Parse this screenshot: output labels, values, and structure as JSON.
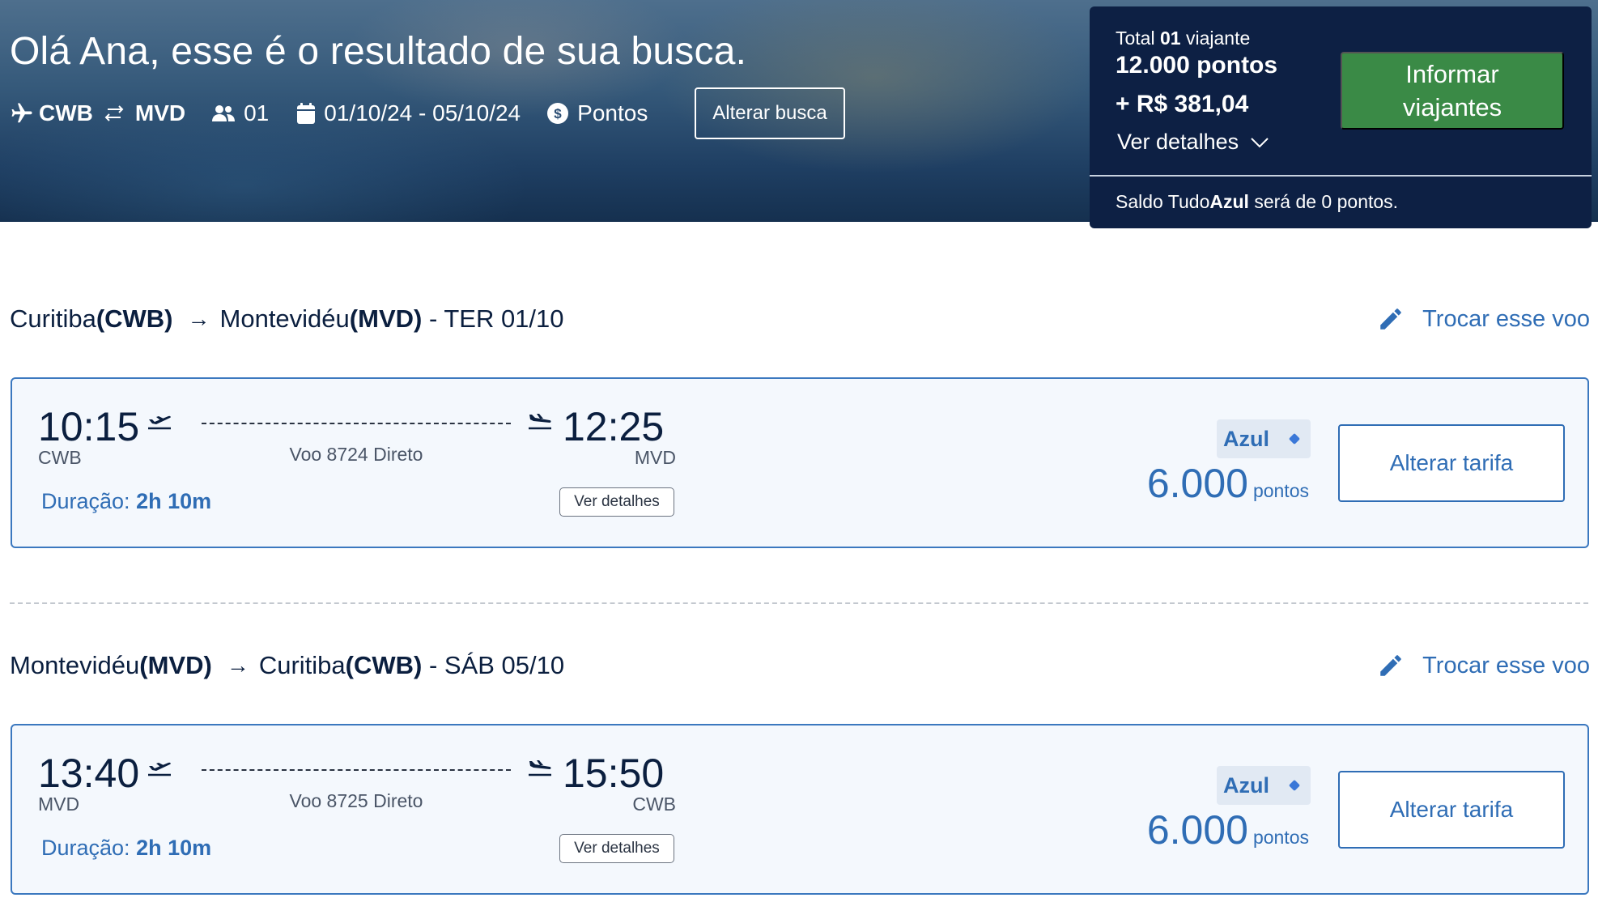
{
  "hero": {
    "greeting": "Olá Ana, esse é o resultado de sua busca.",
    "origin": "CWB",
    "destination": "MVD",
    "passengers": "01",
    "dates": "01/10/24 - 05/10/24",
    "payment": "Pontos",
    "alter_search_label": "Alterar busca"
  },
  "summary": {
    "total_prefix": "Total ",
    "total_count": "01",
    "total_suffix": " viajante",
    "points_total": "12.000 pontos",
    "money_total": "+ R$ 381,04",
    "details_label": "Ver detalhes",
    "cta_label_line1": "Informar",
    "cta_label_line2": "viajantes",
    "balance_prefix": "Saldo Tudo",
    "balance_brand": "Azul",
    "balance_suffix": " será de 0 pontos."
  },
  "legs": [
    {
      "from_city": "Curitiba ",
      "from_code": "(CWB)",
      "to_city": "Montevidéu ",
      "to_code": "(MVD)",
      "date": " - TER 01/10",
      "swap_label": "Trocar esse voo",
      "departure_time": "10:15",
      "departure_code": "CWB",
      "arrival_time": "12:25",
      "arrival_code": "MVD",
      "flight_info": "Voo 8724 Direto",
      "duration_label": "Duração: ",
      "duration_value": "2h 10m",
      "details_label": "Ver detalhes",
      "fare_name": "Azul",
      "points_value": "6.000",
      "points_unit": "pontos",
      "change_fare_label": "Alterar tarifa"
    },
    {
      "from_city": "Montevidéu ",
      "from_code": "(MVD)",
      "to_city": "Curitiba ",
      "to_code": "(CWB)",
      "date": " - SÁB 05/10",
      "swap_label": "Trocar esse voo",
      "departure_time": "13:40",
      "departure_code": "MVD",
      "arrival_time": "15:50",
      "arrival_code": "CWB",
      "flight_info": "Voo 8725 Direto",
      "duration_label": "Duração: ",
      "duration_value": "2h 10m",
      "details_label": "Ver detalhes",
      "fare_name": "Azul",
      "points_value": "6.000",
      "points_unit": "pontos",
      "change_fare_label": "Alterar tarifa"
    }
  ],
  "colors": {
    "navy": "#0d2044",
    "brand_blue": "#2f6db5",
    "cta_green": "#3a8a46"
  },
  "icons": {
    "search_bar": [
      "plane-icon",
      "swap-arrows-icon",
      "people-icon",
      "calendar-icon",
      "currency-icon"
    ],
    "panel": [
      "chevron-down-icon"
    ],
    "legs": [
      "arrow-right-icon",
      "pencil-icon",
      "takeoff-icon",
      "landing-icon",
      "diamond-icon"
    ]
  }
}
